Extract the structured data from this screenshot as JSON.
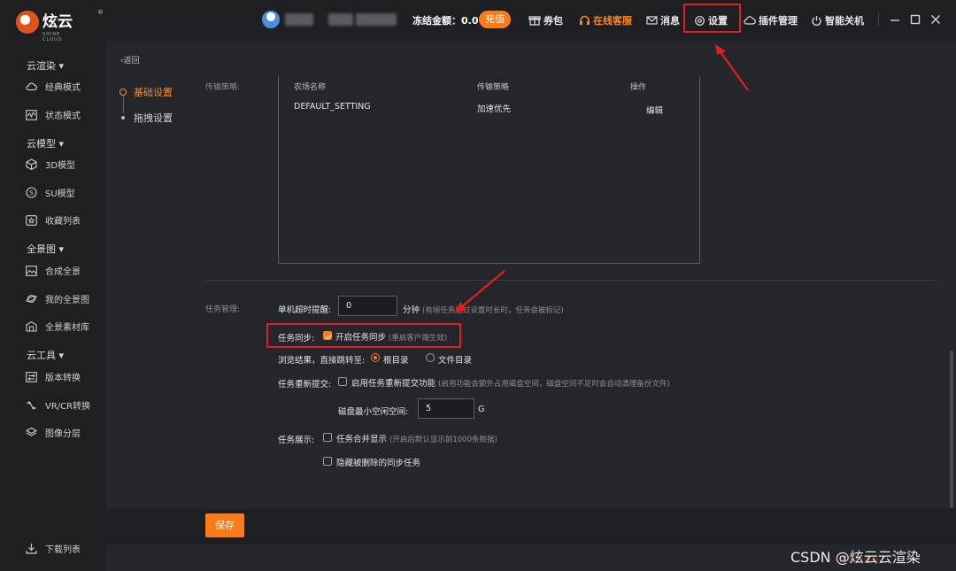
{
  "brand": {
    "name": "炫云",
    "sub": "SHINE CLOUD",
    "reg": "®"
  },
  "header": {
    "balance_label": "冻结金额：0.0",
    "recharge": "充值",
    "items": {
      "task_package": "券包",
      "online_service": "在线客服",
      "messages": "消息",
      "settings": "设置",
      "plugin_mgmt": "插件管理",
      "smart_shutdown": "智能关机"
    }
  },
  "sidebar": {
    "groups": [
      {
        "label": "云渲染 ▾",
        "items": [
          "经典模式",
          "状态模式"
        ]
      },
      {
        "label": "云模型 ▾",
        "items": [
          "3D模型",
          "SU模型",
          "收藏列表"
        ]
      },
      {
        "label": "全景图 ▾",
        "items": [
          "合成全景",
          "我的全景图",
          "全景素材库"
        ]
      },
      {
        "label": "云工具 ▾",
        "items": [
          "版本转换",
          "VR/CR转换",
          "图像分层"
        ]
      }
    ],
    "download_list": "下载列表"
  },
  "main": {
    "back": "返回",
    "nav": {
      "basic": "基础设置",
      "drag": "拖拽设置"
    },
    "transfer_label": "传输策略:",
    "table": {
      "headers": [
        "农场名称",
        "传输策略",
        "操作"
      ],
      "rows": [
        [
          "DEFAULT_SETTING",
          "加速优先",
          "编辑"
        ]
      ]
    },
    "task_mgmt_label": "任务管理:",
    "timeout": {
      "label": "单机超时提醒:",
      "value": "0",
      "unit": "分钟",
      "hint": "(有帧任务超过设置时长时，任务会被标记)"
    },
    "sync": {
      "label": "任务同步:",
      "checkbox": "开启任务同步",
      "hint": "(重启客户端生效)",
      "checked": true
    },
    "browse": {
      "label": "浏览结果，直接跳转至:",
      "opt1": "根目录",
      "opt2": "文件目录",
      "selected": "根目录"
    },
    "resubmit": {
      "label": "任务重新提交:",
      "checkbox": "启用任务重新提交功能",
      "hint": "(启用功能会额外占用磁盘空间，磁盘空间不足时会自动清理备份文件)",
      "checked": false
    },
    "disk": {
      "label": "磁盘最小空闲空间:",
      "value": "5",
      "unit": "G"
    },
    "display": {
      "label": "任务展示:",
      "merge": "任务合并显示",
      "merge_hint": "(开启后默认显示前1000条数据)",
      "hide_deleted": "隐藏被删除的同步任务"
    },
    "save": "保存"
  },
  "watermark": "CSDN @炫云云渲染",
  "watermark2": "炫云云渲染",
  "colors": {
    "accent": "#ff7a18",
    "highlight": "#e02020",
    "bg": "#1e1f23",
    "panel": "#25262b"
  }
}
